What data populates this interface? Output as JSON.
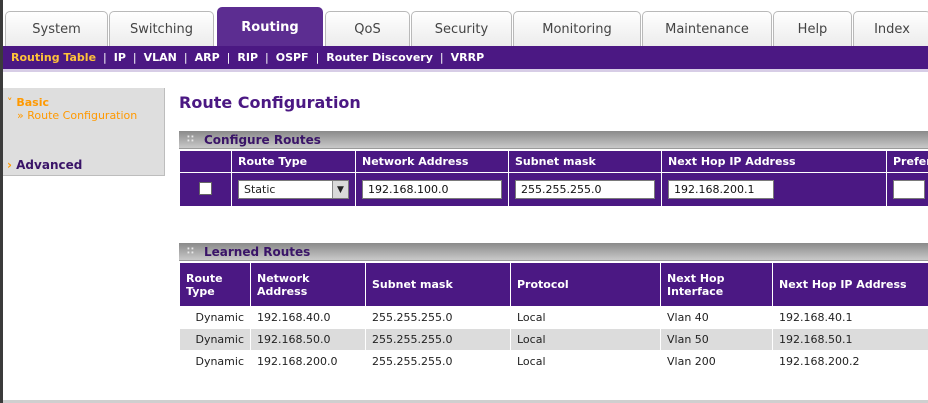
{
  "tabs": [
    "System",
    "Switching",
    "Routing",
    "QoS",
    "Security",
    "Monitoring",
    "Maintenance",
    "Help",
    "Index"
  ],
  "active_tab": "Routing",
  "subnav": [
    "Routing Table",
    "IP",
    "VLAN",
    "ARP",
    "RIP",
    "OSPF",
    "Router Discovery",
    "VRRP"
  ],
  "active_subnav": "Routing Table",
  "sidebar": {
    "basic": "Basic",
    "sub_item": "» Route Configuration",
    "advanced": "Advanced"
  },
  "page_title": "Route Configuration",
  "configure": {
    "section_title": "Configure Routes",
    "headers": [
      "Route Type",
      "Network Address",
      "Subnet mask",
      "Next Hop IP Address",
      "Prefer"
    ],
    "route_type": "Static",
    "network_address": "192.168.100.0",
    "subnet_mask": "255.255.255.0",
    "next_hop_ip": "192.168.200.1",
    "preference": ""
  },
  "learned": {
    "section_title": "Learned Routes",
    "headers": [
      "Route Type",
      "Network Address",
      "Subnet mask",
      "Protocol",
      "Next Hop Interface",
      "Next Hop IP Address"
    ],
    "rows": [
      [
        "Dynamic",
        "192.168.40.0",
        "255.255.255.0",
        "Local",
        "Vlan 40",
        "192.168.40.1"
      ],
      [
        "Dynamic",
        "192.168.50.0",
        "255.255.255.0",
        "Local",
        "Vlan 50",
        "192.168.50.1"
      ],
      [
        "Dynamic",
        "192.168.200.0",
        "255.255.255.0",
        "Local",
        "Vlan 200",
        "192.168.200.2"
      ]
    ]
  },
  "colors": {
    "brand_purple": "#4b1883",
    "active_orange": "#ffc23a"
  }
}
